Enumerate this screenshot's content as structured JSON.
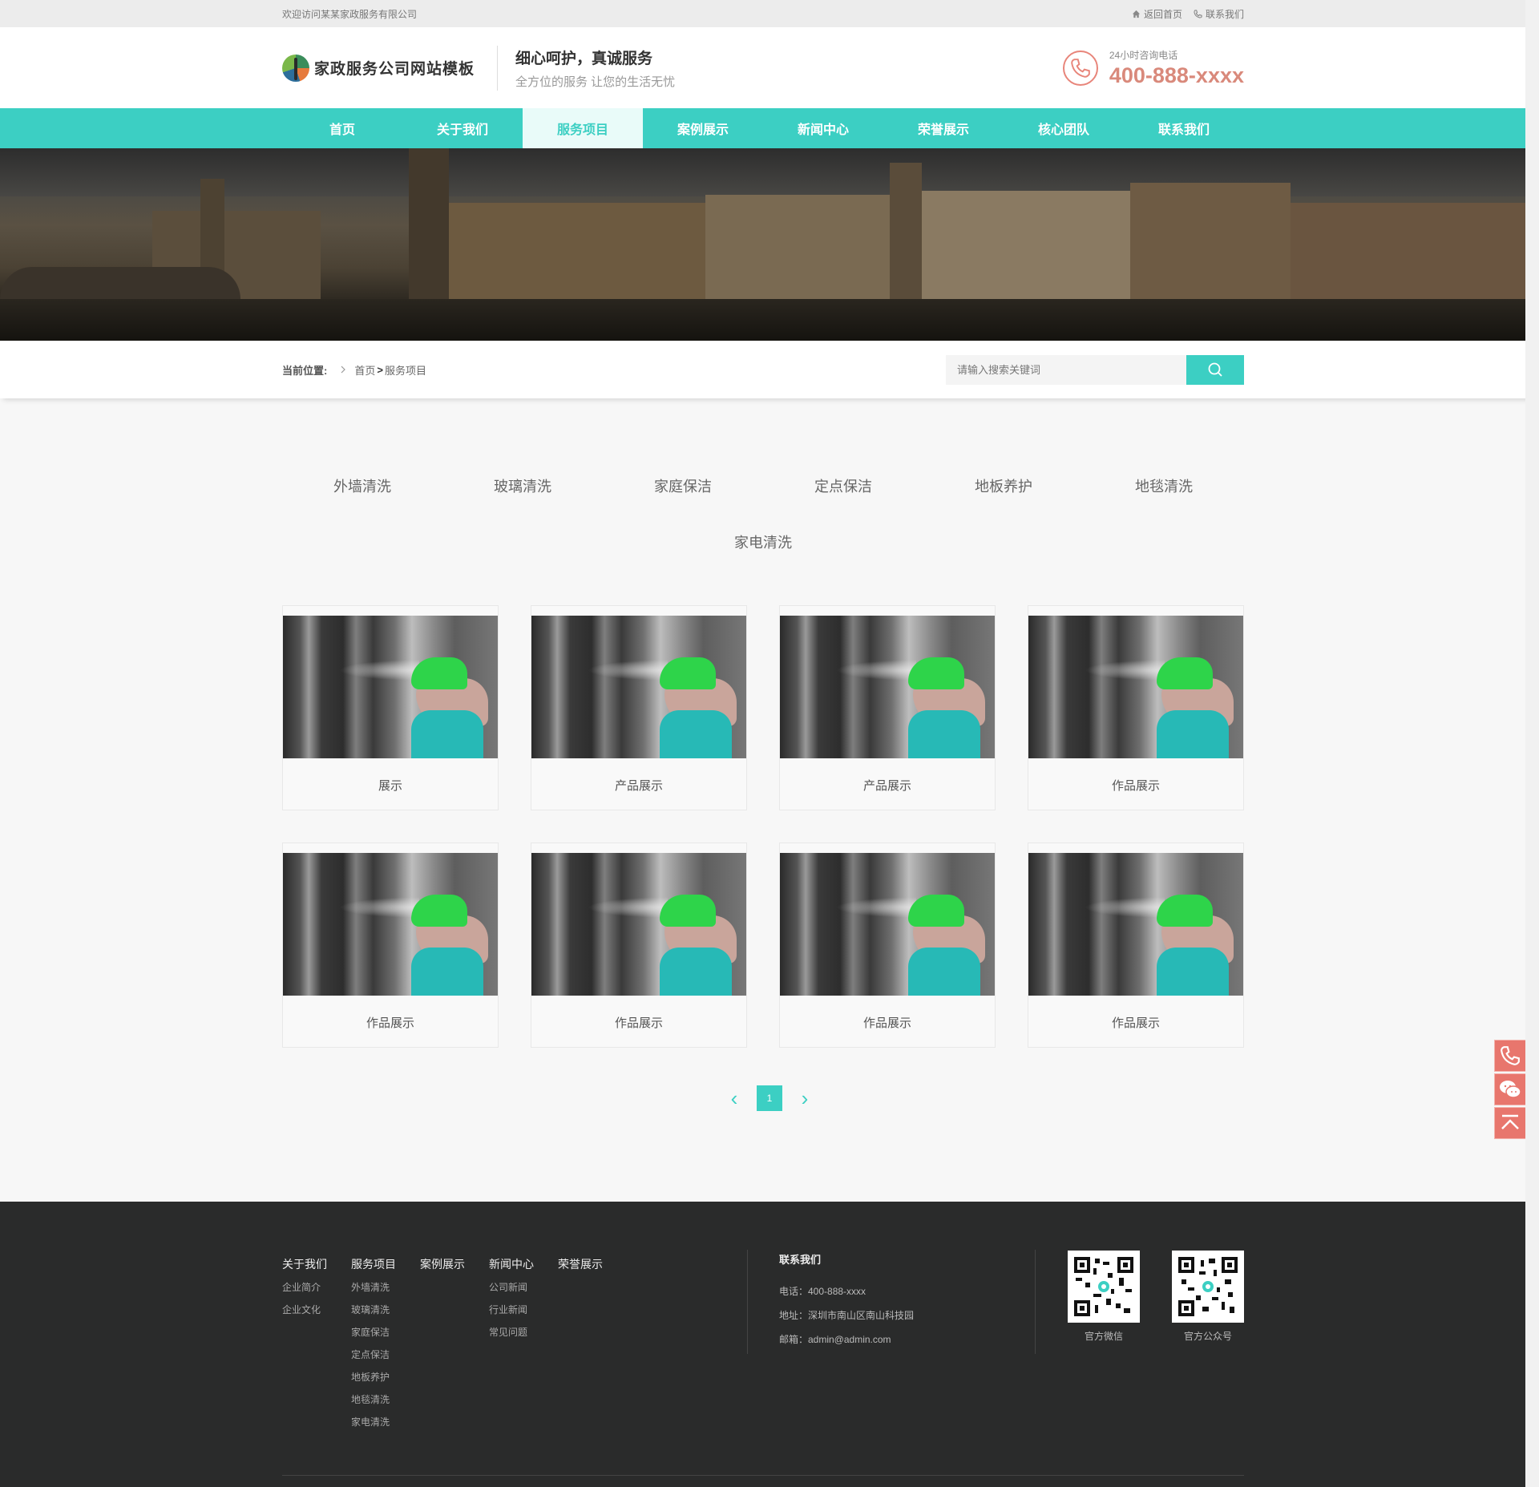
{
  "topbar": {
    "welcome": "欢迎访问某某家政服务有限公司",
    "home_link": "返回首页",
    "contact_link": "联系我们"
  },
  "header": {
    "logo_text": "家政服务公司网站模板",
    "slogan_title": "细心呵护，真诚服务",
    "slogan_sub": "全方位的服务 让您的生活无忧",
    "hotline_label": "24小时咨询电话",
    "hotline_number": "400-888-xxxx"
  },
  "nav": {
    "items": [
      {
        "label": "首页"
      },
      {
        "label": "关于我们"
      },
      {
        "label": "服务项目"
      },
      {
        "label": "案例展示"
      },
      {
        "label": "新闻中心"
      },
      {
        "label": "荣誉展示"
      },
      {
        "label": "核心团队"
      },
      {
        "label": "联系我们"
      }
    ],
    "active": "服务项目"
  },
  "breadcrumb": {
    "label": "当前位置:",
    "home": "首页",
    "arrow": ">",
    "current": "服务项目"
  },
  "search": {
    "placeholder": "请输入搜索关键词"
  },
  "categories": [
    "外墙清洗",
    "玻璃清洗",
    "家庭保洁",
    "定点保洁",
    "地板养护",
    "地毯清洗",
    "家电清洗"
  ],
  "products": [
    {
      "title": "展示"
    },
    {
      "title": "产品展示"
    },
    {
      "title": "产品展示"
    },
    {
      "title": "作品展示"
    },
    {
      "title": "作品展示"
    },
    {
      "title": "作品展示"
    },
    {
      "title": "作品展示"
    },
    {
      "title": "作品展示"
    }
  ],
  "pagination": {
    "current_page": "1",
    "prev": "‹",
    "next": "›"
  },
  "footer": {
    "columns": [
      {
        "title": "关于我们",
        "links": [
          "企业简介",
          "企业文化"
        ]
      },
      {
        "title": "服务项目",
        "links": [
          "外墙清洗",
          "玻璃清洗",
          "家庭保洁",
          "定点保洁",
          "地板养护",
          "地毯清洗",
          "家电清洗"
        ]
      },
      {
        "title": "案例展示",
        "links": []
      },
      {
        "title": "新闻中心",
        "links": [
          "公司新闻",
          "行业新闻",
          "常见问题"
        ]
      },
      {
        "title": "荣誉展示",
        "links": []
      }
    ],
    "contact": {
      "title": "联系我们",
      "phone": "电话：400-888-xxxx",
      "address": "地址：深圳市南山区南山科技园",
      "email": "邮箱：admin@admin.com"
    },
    "qr_codes": [
      {
        "caption": "官方微信"
      },
      {
        "caption": "官方公众号"
      }
    ]
  },
  "colors": {
    "accent": "#3ccfc3",
    "hotline": "#d9897b",
    "footer_bg": "#2a2b2b",
    "float_bg": "#e8766d"
  }
}
